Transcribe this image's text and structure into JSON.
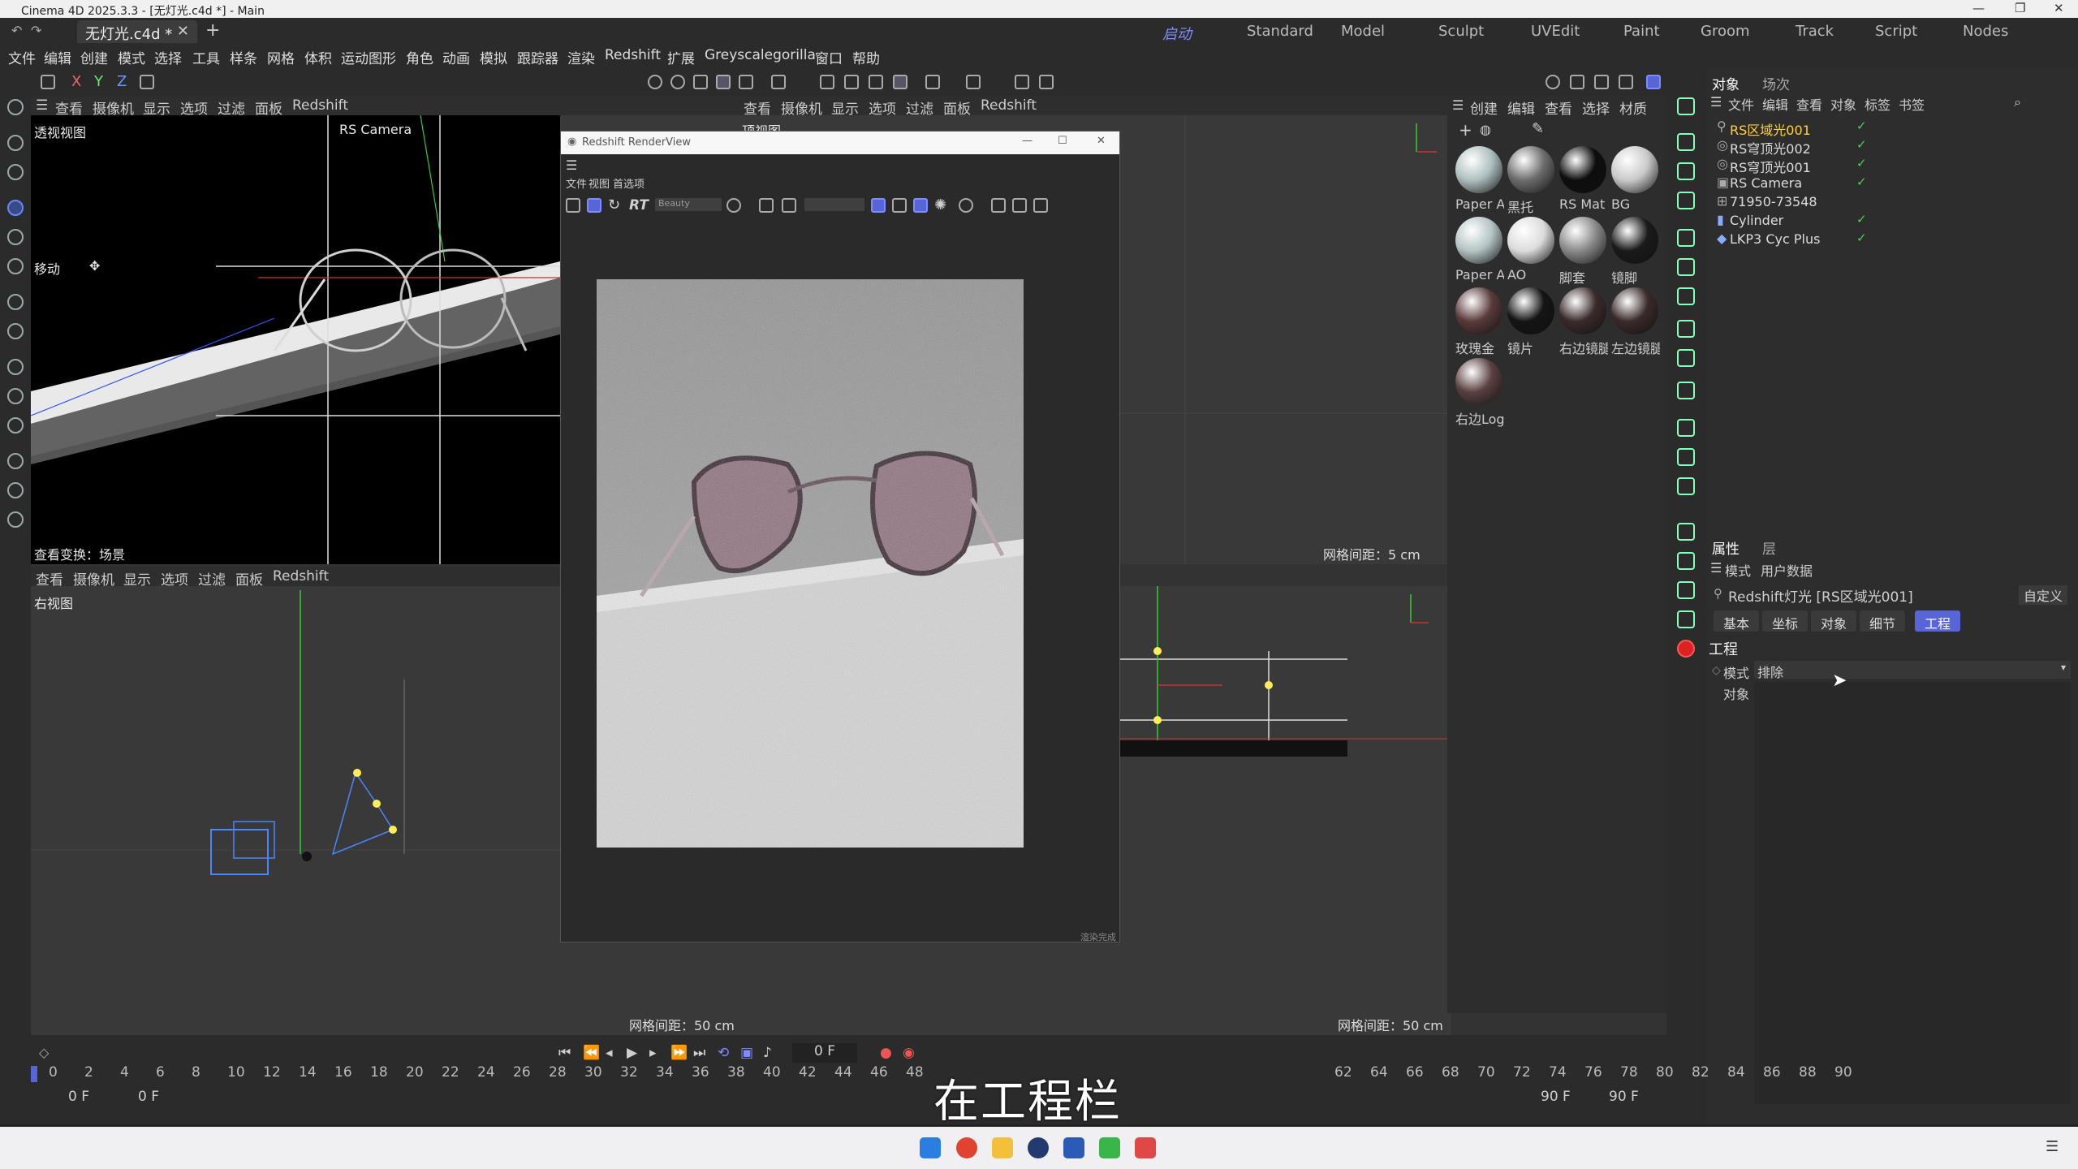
{
  "window": {
    "title": "Cinema 4D 2025.3.3 - [无灯光.c4d *] - Main"
  },
  "doc_tab": {
    "label": "无灯光.c4d *"
  },
  "layouts": [
    "启动",
    "Standard",
    "Model",
    "Sculpt",
    "UVEdit",
    "Paint",
    "Groom",
    "Track",
    "Script",
    "Nodes"
  ],
  "menu": [
    "文件",
    "编辑",
    "创建",
    "模式",
    "选择",
    "工具",
    "样条",
    "网格",
    "体积",
    "运动图形",
    "角色",
    "动画",
    "模拟",
    "跟踪器",
    "渲染",
    "Redshift",
    "扩展",
    "Greyscalegorilla",
    "窗口",
    "帮助"
  ],
  "axes": [
    "X",
    "Y",
    "Z"
  ],
  "viewport_menu": [
    "查看",
    "摄像机",
    "显示",
    "选项",
    "过滤",
    "面板",
    "Redshift"
  ],
  "viewports": {
    "perspective": {
      "label": "透视视图",
      "camera": "RS Camera",
      "move": "移动",
      "transform": "查看变换：场景"
    },
    "top": {
      "label": "顶视图",
      "grid": "网格间距：5 cm"
    },
    "right": {
      "label": "右视图",
      "grid": "网格间距：50 cm"
    },
    "front": {
      "grid": "网格间距：50 cm"
    }
  },
  "render_view": {
    "title": "Redshift RenderView",
    "menu": [
      "文件",
      "视图",
      "首选项"
    ],
    "rt": "RT",
    "aov": "Beauty",
    "footer": "渲染完成"
  },
  "materials_menu": [
    "创建",
    "编辑",
    "查看",
    "选择",
    "材质"
  ],
  "materials": [
    {
      "name": "Paper A",
      "color": "#aebfc0"
    },
    {
      "name": "黑托",
      "color": "#6d6d6d"
    },
    {
      "name": "RS Mat",
      "color": "#0d0d0d"
    },
    {
      "name": "BG",
      "color": "#c9c9c9"
    },
    {
      "name": "Paper A",
      "color": "#b4c3c4"
    },
    {
      "name": "AO",
      "color": "#dcdcdc"
    },
    {
      "name": "脚套",
      "color": "#8a8a8a"
    },
    {
      "name": "镜脚",
      "color": "#1a1a1a"
    },
    {
      "name": "玫瑰金",
      "color": "#5a3a3a"
    },
    {
      "name": "镜片",
      "color": "#141414"
    },
    {
      "name": "右边镜腿",
      "color": "#3a2a2a"
    },
    {
      "name": "左边镜腿",
      "color": "#3a2a2a"
    },
    {
      "name": "右边Log",
      "color": "#5a4040"
    }
  ],
  "object_panel": {
    "tabs": [
      "对象",
      "场次"
    ],
    "menu": [
      "文件",
      "编辑",
      "查看",
      "对象",
      "标签",
      "书签"
    ],
    "items": [
      "RS区域光001",
      "RS穹顶光002",
      "RS穹顶光001",
      "RS Camera",
      "71950-73548",
      "Cylinder",
      "LKP3 Cyc Plus"
    ]
  },
  "attr_panel": {
    "tabs": [
      "属性",
      "层"
    ],
    "menu": [
      "模式",
      "用户数据"
    ],
    "object_title": "Redshift灯光 [RS区域光001]",
    "custom": "自定义",
    "sub_tabs": [
      "基本",
      "坐标",
      "对象",
      "细节",
      "工程"
    ],
    "section": "工程",
    "mode_label": "模式",
    "mode_value": "排除",
    "object_label": "对象"
  },
  "timeline": {
    "ticks": [
      "0",
      "2",
      "4",
      "6",
      "8",
      "10",
      "12",
      "14",
      "16",
      "18",
      "20",
      "22",
      "24",
      "26",
      "28",
      "30",
      "32",
      "34",
      "36",
      "38",
      "40",
      "42",
      "44",
      "46",
      "48",
      "",
      "",
      "",
      "",
      "",
      "",
      "",
      "",
      "",
      "",
      "",
      "62",
      "64",
      "66",
      "68",
      "70",
      "72",
      "74",
      "76",
      "78",
      "80",
      "82",
      "84",
      "86",
      "88",
      "90"
    ],
    "current": "0 F",
    "start": "0 F",
    "start2": "0 F",
    "end": "90 F",
    "end2": "90 F"
  },
  "subtitle": "在工程栏"
}
